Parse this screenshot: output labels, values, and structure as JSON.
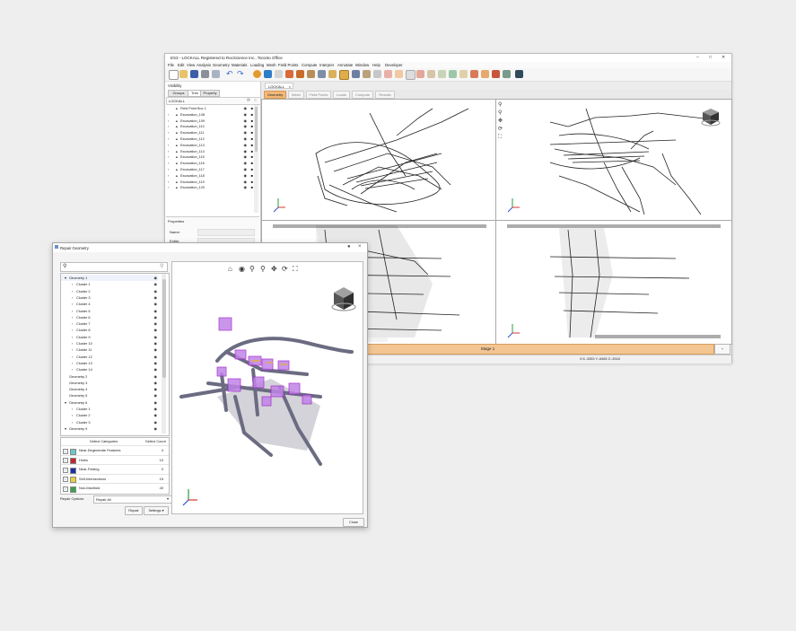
{
  "main_window": {
    "title": "ES3 - LOCKALL    Registered to RocScience Inc., Toronto Office",
    "menu": [
      "File",
      "Edit",
      "View",
      "Analysis",
      "Geometry",
      "Materials",
      "Loading",
      "Mesh",
      "Field Points",
      "Compute",
      "Interpret",
      "Annotate",
      "Window",
      "Help",
      "Developer"
    ],
    "panel_title": "Visibility",
    "panel_tabs": [
      "Groups",
      "Tree",
      "Property"
    ],
    "tree_root": "LOCKALL",
    "tree_items": [
      "Field Point Box 1",
      "Excavation_108",
      "Excavation_109",
      "Excavation_110",
      "Excavation_111",
      "Excavation_112",
      "Excavation_113",
      "Excavation_114",
      "Excavation_115",
      "Excavation_116",
      "Excavation_117",
      "Excavation_118",
      "Excavation_119",
      "Excavation_120"
    ],
    "properties_title": "Properties",
    "prop_name": "Name:",
    "prop_entity": "Entity:",
    "doc_tab": "LOCKALL",
    "view_tabs": [
      "Geometry",
      "Mesh",
      "Field Points",
      "Loads",
      "Compute",
      "Results"
    ],
    "stage_label": "Stage 1",
    "status_coords": "X:5 -3353  Y:-6463  Z:-3318"
  },
  "dialog": {
    "title": "Repair Geometry",
    "tree": [
      {
        "label": "Geometry 1",
        "level": 0,
        "exp": true
      },
      {
        "label": "Cluster 1",
        "level": 1
      },
      {
        "label": "Cluster 2",
        "level": 1
      },
      {
        "label": "Cluster 3",
        "level": 1
      },
      {
        "label": "Cluster 4",
        "level": 1
      },
      {
        "label": "Cluster 5",
        "level": 1
      },
      {
        "label": "Cluster 6",
        "level": 1
      },
      {
        "label": "Cluster 7",
        "level": 1
      },
      {
        "label": "Cluster 8",
        "level": 1
      },
      {
        "label": "Cluster 9",
        "level": 1
      },
      {
        "label": "Cluster 10",
        "level": 1
      },
      {
        "label": "Cluster 11",
        "level": 1
      },
      {
        "label": "Cluster 12",
        "level": 1
      },
      {
        "label": "Cluster 13",
        "level": 1
      },
      {
        "label": "Cluster 14",
        "level": 1
      },
      {
        "label": "Geometry 2",
        "level": 0
      },
      {
        "label": "Geometry 3",
        "level": 0
      },
      {
        "label": "Geometry 4",
        "level": 0
      },
      {
        "label": "Geometry 5",
        "level": 0
      },
      {
        "label": "Geometry 6",
        "level": 0,
        "exp": true
      },
      {
        "label": "Cluster 1",
        "level": 1
      },
      {
        "label": "Cluster 2",
        "level": 1
      },
      {
        "label": "Cluster 3",
        "level": 1
      },
      {
        "label": "Geometry 9",
        "level": 0,
        "exp": true
      }
    ],
    "defect_header": "Defect Categories",
    "count_header": "Defect Count",
    "defects": [
      {
        "name": "Near-Degenerate Features",
        "count": "4",
        "color": "#6ec6c8"
      },
      {
        "name": "Holes",
        "count": "10",
        "color": "#c0262b"
      },
      {
        "name": "Near-Folding",
        "count": "0",
        "color": "#1b2fa8"
      },
      {
        "name": "Self-Intersections",
        "count": "15",
        "color": "#e8d23b"
      },
      {
        "name": "Non-Manifold",
        "count": "40",
        "color": "#3aa14a"
      }
    ],
    "repair_options_label": "Repair Options:",
    "repair_options_value": "Repair All",
    "repair_button": "Repair",
    "settings_button": "Settings",
    "close_button": "Close"
  }
}
